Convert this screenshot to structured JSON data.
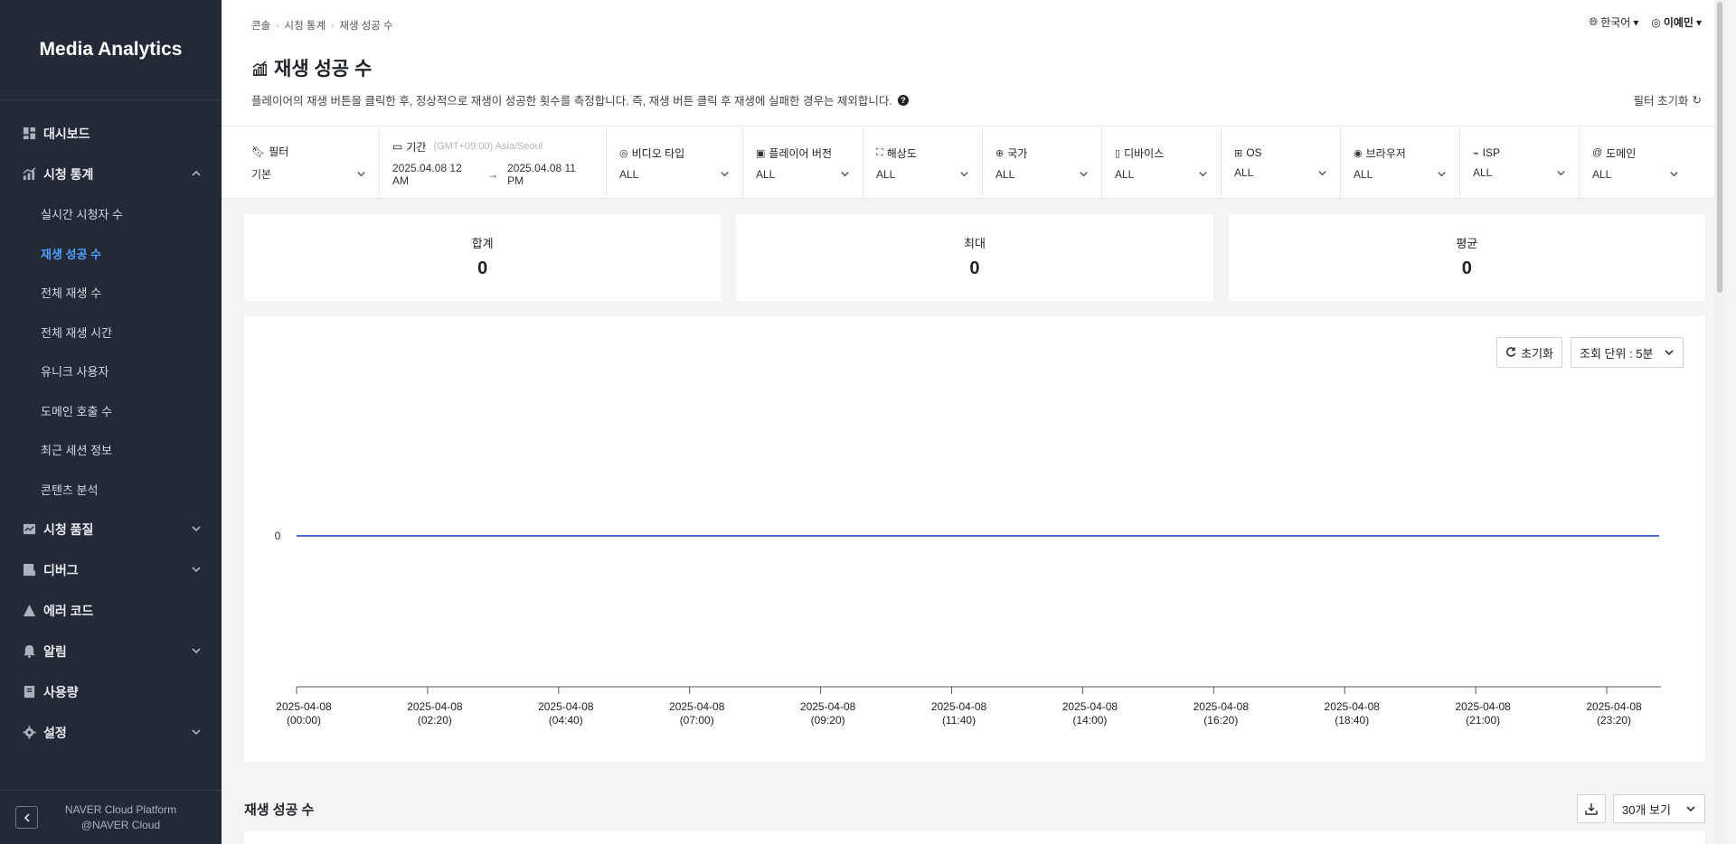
{
  "sidebar": {
    "brand": "Media Analytics",
    "items": [
      {
        "label": "대시보드",
        "icon": "dashboard-icon",
        "expandable": false
      },
      {
        "label": "시청 통계",
        "icon": "stats-icon",
        "expandable": true,
        "expanded": true,
        "children": [
          "실시간 시청자 수",
          "재생 성공 수",
          "전체 재생 수",
          "전체 재생 시간",
          "유니크 사용자",
          "도메인 호출 수",
          "최근 세션 정보",
          "콘텐츠 분석"
        ],
        "active_child": "재생 성공 수"
      },
      {
        "label": "시청 품질",
        "icon": "quality-icon",
        "expandable": true
      },
      {
        "label": "디버그",
        "icon": "debug-icon",
        "expandable": true
      },
      {
        "label": "에러 코드",
        "icon": "warning-icon",
        "expandable": false
      },
      {
        "label": "알림",
        "icon": "bell-icon",
        "expandable": true
      },
      {
        "label": "사용량",
        "icon": "usage-icon",
        "expandable": false
      },
      {
        "label": "설정",
        "icon": "gear-icon",
        "expandable": true
      }
    ],
    "footer": {
      "line1": "NAVER Cloud Platform",
      "line2": "@NAVER Cloud"
    }
  },
  "header": {
    "breadcrumb": [
      "콘솔",
      "시청 통계",
      "재생 성공 수"
    ],
    "language": "한국어",
    "user": "이예민",
    "title": "재생 성공 수",
    "description": "플레이어의 재생 버튼을 클릭한 후, 정상적으로 재생이 성공한 횟수를 측정합니다. 즉, 재생 버튼 클릭 후 재생에 실패한 경우는 제외합니다.",
    "reset_filter": "필터 초기화"
  },
  "filters": {
    "preset": {
      "label": "필터",
      "value": "기본"
    },
    "period": {
      "label": "기간",
      "tz": "(GMT+09:00) Asia/Seoul",
      "start": "2025.04.08 12 AM",
      "end": "2025.04.08 11 PM"
    },
    "dropdowns": [
      {
        "label": "비디오 타입",
        "value": "ALL",
        "icon": "video-type-icon"
      },
      {
        "label": "플레이어 버전",
        "value": "ALL",
        "icon": "player-icon"
      },
      {
        "label": "해상도",
        "value": "ALL",
        "icon": "resolution-icon"
      },
      {
        "label": "국가",
        "value": "ALL",
        "icon": "globe-icon"
      },
      {
        "label": "디바이스",
        "value": "ALL",
        "icon": "device-icon"
      },
      {
        "label": "OS",
        "value": "ALL",
        "icon": "os-icon"
      },
      {
        "label": "브라우저",
        "value": "ALL",
        "icon": "browser-icon"
      },
      {
        "label": "ISP",
        "value": "ALL",
        "icon": "isp-icon"
      },
      {
        "label": "도메인",
        "value": "ALL",
        "icon": "domain-icon"
      }
    ]
  },
  "stats": [
    {
      "label": "합계",
      "value": "0"
    },
    {
      "label": "최대",
      "value": "0"
    },
    {
      "label": "평균",
      "value": "0"
    }
  ],
  "chart_controls": {
    "reset": "초기화",
    "interval": "조회 단위 : 5분"
  },
  "chart_data": {
    "type": "line",
    "x": [
      "2025-04-08 (00:00)",
      "2025-04-08 (02:20)",
      "2025-04-08 (04:40)",
      "2025-04-08 (07:00)",
      "2025-04-08 (09:20)",
      "2025-04-08 (11:40)",
      "2025-04-08 (14:00)",
      "2025-04-08 (16:20)",
      "2025-04-08 (18:40)",
      "2025-04-08 (21:00)",
      "2025-04-08 (23:20)"
    ],
    "x_ticks": [
      {
        "date": "2025-04-08",
        "time": "(00:00)"
      },
      {
        "date": "2025-04-08",
        "time": "(02:20)"
      },
      {
        "date": "2025-04-08",
        "time": "(04:40)"
      },
      {
        "date": "2025-04-08",
        "time": "(07:00)"
      },
      {
        "date": "2025-04-08",
        "time": "(09:20)"
      },
      {
        "date": "2025-04-08",
        "time": "(11:40)"
      },
      {
        "date": "2025-04-08",
        "time": "(14:00)"
      },
      {
        "date": "2025-04-08",
        "time": "(16:20)"
      },
      {
        "date": "2025-04-08",
        "time": "(18:40)"
      },
      {
        "date": "2025-04-08",
        "time": "(21:00)"
      },
      {
        "date": "2025-04-08",
        "time": "(23:20)"
      }
    ],
    "y_ticks": [
      "0"
    ],
    "series": [
      {
        "values": [
          0,
          0,
          0,
          0,
          0,
          0,
          0,
          0,
          0,
          0,
          0
        ],
        "color": "#3355cc"
      }
    ],
    "xlabel": "",
    "ylabel": ""
  },
  "table": {
    "title": "재생 성공 수",
    "page_size": "30개 보기"
  }
}
